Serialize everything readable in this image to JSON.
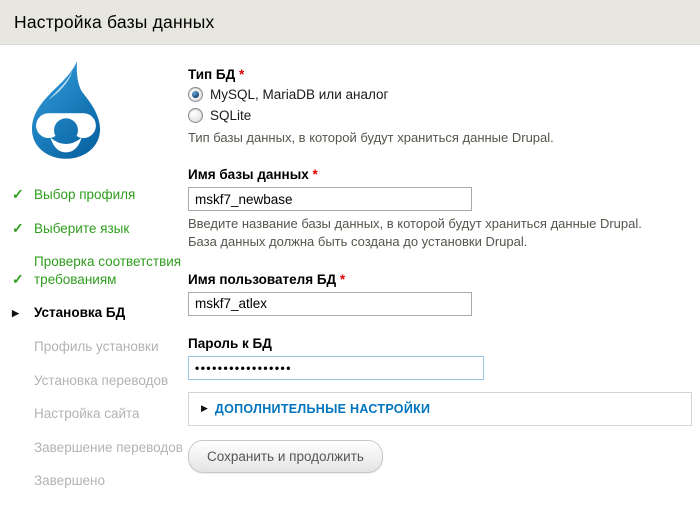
{
  "header": {
    "title": "Настройка базы данных"
  },
  "sidebar": {
    "items": [
      {
        "label": "Выбор профиля",
        "state": "done"
      },
      {
        "label": "Выберите язык",
        "state": "done"
      },
      {
        "label": "Проверка соответствия требованиям",
        "state": "done"
      },
      {
        "label": "Установка БД",
        "state": "active"
      },
      {
        "label": "Профиль установки",
        "state": "pending"
      },
      {
        "label": "Установка переводов",
        "state": "pending"
      },
      {
        "label": "Настройка сайта",
        "state": "pending"
      },
      {
        "label": "Завершение переводов",
        "state": "pending"
      },
      {
        "label": "Завершено",
        "state": "pending"
      }
    ]
  },
  "form": {
    "required_marker": "*",
    "db_type": {
      "label": "Тип БД",
      "options": [
        {
          "label": "MySQL, MariaDB или аналог",
          "selected": true
        },
        {
          "label": "SQLite",
          "selected": false
        }
      ],
      "description": "Тип базы данных, в которой будут храниться данные Drupal."
    },
    "db_name": {
      "label": "Имя базы данных",
      "value": "mskf7_newbase",
      "description": "Введите название базы данных, в которой будут храниться данные Drupal. База данных должна быть создана до установки Drupal."
    },
    "db_user": {
      "label": "Имя пользователя БД",
      "value": "mskf7_atlex"
    },
    "db_password": {
      "label": "Пароль к БД",
      "value": "•••••••••••••••••"
    },
    "advanced": {
      "label": "ДОПОЛНИТЕЛЬНЫЕ НАСТРОЙКИ"
    },
    "submit_label": "Сохранить и продолжить"
  },
  "icons": {
    "check": "✓",
    "caret": "▶"
  },
  "colors": {
    "header_bg": "#e8e7df",
    "accent_blue": "#0074bd",
    "success_green": "#2f9e1e",
    "logo_blue": "#0678be",
    "required_red": "#e00000"
  }
}
